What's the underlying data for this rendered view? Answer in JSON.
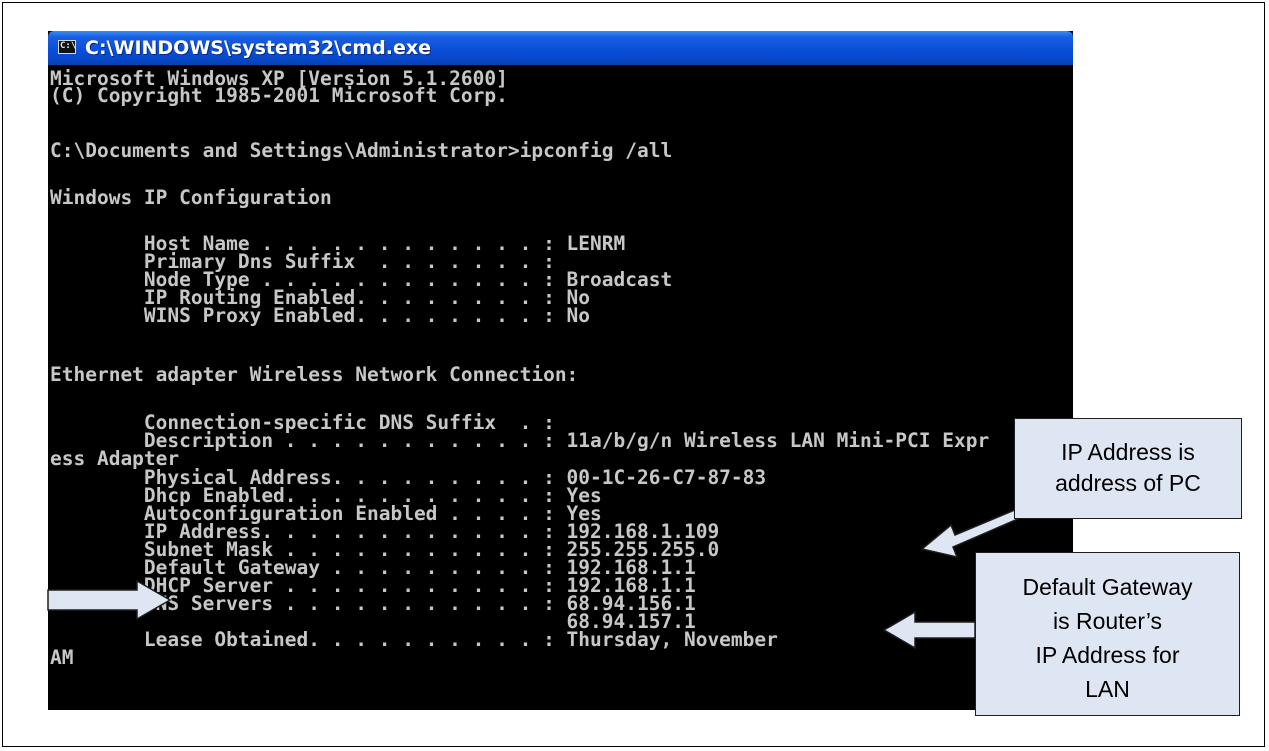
{
  "window": {
    "title": "C:\\WINDOWS\\system32\\cmd.exe",
    "icon": "cmd-prompt-icon",
    "icon_glyph": "C:\\"
  },
  "console_lines": [
    "Microsoft Windows XP [Version 5.1.2600]",
    "(C) Copyright 1985-2001 Microsoft Corp.",
    "",
    "C:\\Documents and Settings\\Administrator>ipconfig /all",
    "",
    "Windows IP Configuration",
    "",
    "        Host Name . . . . . . . . . . . . : LENRM",
    "        Primary Dns Suffix  . . . . . . . :",
    "        Node Type . . . . . . . . . . . . : Broadcast",
    "        IP Routing Enabled. . . . . . . . : No",
    "        WINS Proxy Enabled. . . . . . . . : No",
    "",
    "Ethernet adapter Wireless Network Connection:",
    "",
    "        Connection-specific DNS Suffix  . :",
    "        Description . . . . . . . . . . . : 11a/b/g/n Wireless LAN Mini-PCI Expr",
    "ess Adapter",
    "        Physical Address. . . . . . . . . : 00-1C-26-C7-87-83",
    "        Dhcp Enabled. . . . . . . . . . . : Yes",
    "        Autoconfiguration Enabled . . . . : Yes",
    "        IP Address. . . . . . . . . . . . : 192.168.1.109",
    "        Subnet Mask . . . . . . . . . . . : 255.255.255.0",
    "        Default Gateway . . . . . . . . . : 192.168.1.1",
    "        DHCP Server . . . . . . . . . . . : 192.168.1.1",
    "        DNS Servers . . . . . . . . . . . : 68.94.156.1",
    "                                            68.94.157.1",
    "        Lease Obtained. . . . . . . . . . : Thursday, November",
    "AM"
  ],
  "callouts": {
    "ip_address": [
      "IP Address is",
      "address of PC"
    ],
    "default_gateway": [
      "Default Gateway",
      "is Router’s",
      "IP Address for",
      "LAN"
    ]
  },
  "colors": {
    "console_bg": "#000000",
    "console_text": "#c7c7c7",
    "titlebar_blue": "#0a4fd8",
    "callout_bg": "#dfe6f3"
  }
}
